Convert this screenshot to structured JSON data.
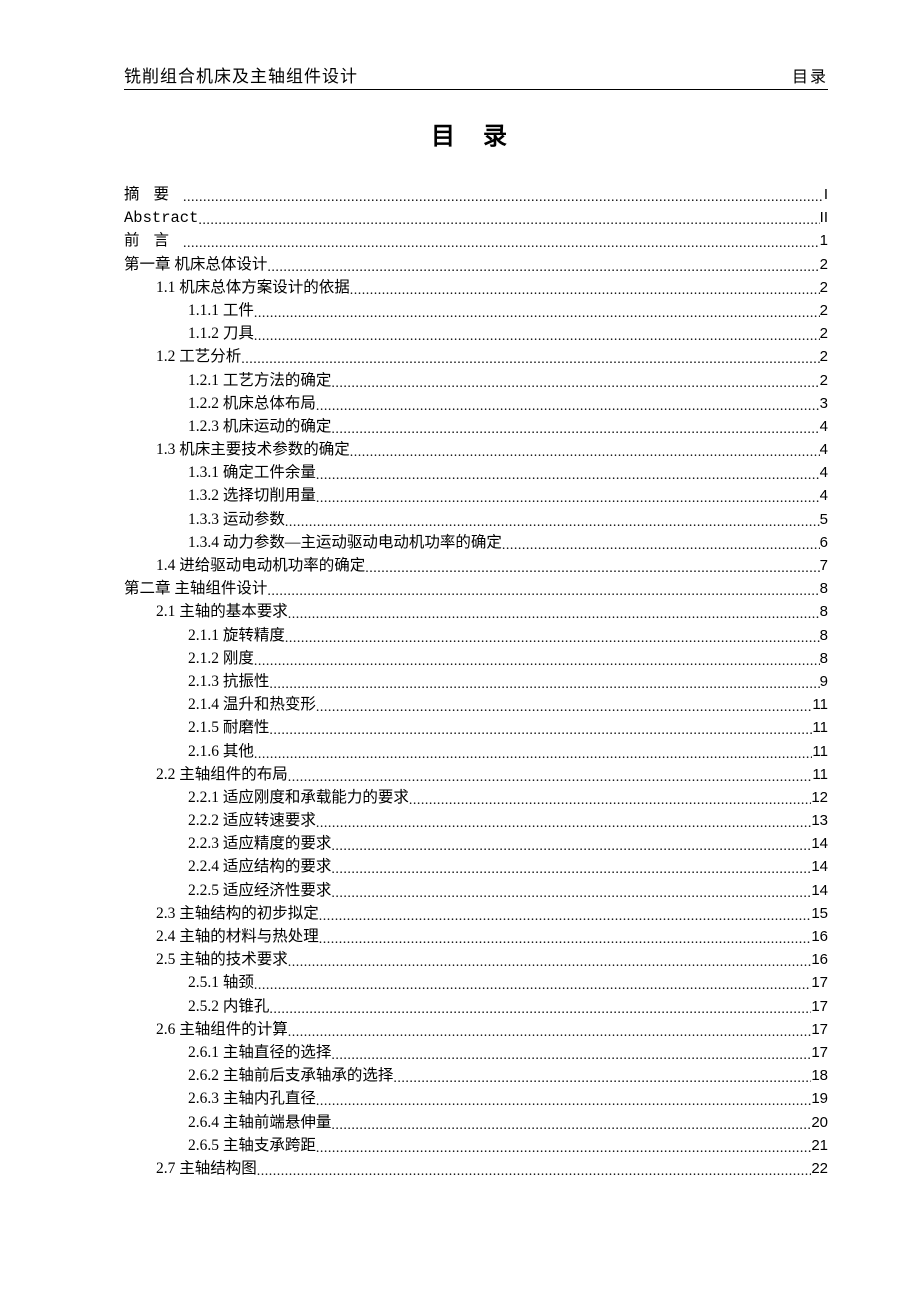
{
  "header": {
    "left": "铣削组合机床及主轴组件设计",
    "right": "目录"
  },
  "title": "目录",
  "toc": [
    {
      "label": "摘要",
      "page": "I",
      "indent": 0,
      "spaced": true
    },
    {
      "label": "Abstract",
      "page": "II",
      "indent": 0,
      "mono": true
    },
    {
      "label": "前言",
      "page": "1",
      "indent": 0,
      "spaced": true
    },
    {
      "label": "第一章 机床总体设计",
      "page": "2",
      "indent": 0
    },
    {
      "label": "1.1 机床总体方案设计的依据",
      "page": "2",
      "indent": 1
    },
    {
      "label": "1.1.1 工件",
      "page": "2",
      "indent": 2
    },
    {
      "label": "1.1.2 刀具",
      "page": "2",
      "indent": 2
    },
    {
      "label": "1.2 工艺分析",
      "page": "2",
      "indent": 1
    },
    {
      "label": "1.2.1 工艺方法的确定",
      "page": "2",
      "indent": 2
    },
    {
      "label": "1.2.2 机床总体布局",
      "page": "3",
      "indent": 2
    },
    {
      "label": "1.2.3 机床运动的确定",
      "page": "4",
      "indent": 2
    },
    {
      "label": "1.3 机床主要技术参数的确定",
      "page": "4",
      "indent": 1
    },
    {
      "label": "1.3.1 确定工件余量",
      "page": "4",
      "indent": 2
    },
    {
      "label": "1.3.2 选择切削用量",
      "page": "4",
      "indent": 2
    },
    {
      "label": "1.3.3 运动参数",
      "page": "5",
      "indent": 2
    },
    {
      "label": "1.3.4 动力参数—主运动驱动电动机功率的确定",
      "page": "6",
      "indent": 2
    },
    {
      "label": "1.4 进给驱动电动机功率的确定",
      "page": "7",
      "indent": 1
    },
    {
      "label": "第二章 主轴组件设计",
      "page": "8",
      "indent": 0
    },
    {
      "label": "2.1 主轴的基本要求",
      "page": "8",
      "indent": 1
    },
    {
      "label": "2.1.1 旋转精度",
      "page": "8",
      "indent": 2
    },
    {
      "label": "2.1.2 刚度",
      "page": "8",
      "indent": 2
    },
    {
      "label": "2.1.3 抗振性",
      "page": "9",
      "indent": 2
    },
    {
      "label": "2.1.4 温升和热变形",
      "page": "11",
      "indent": 2
    },
    {
      "label": "2.1.5 耐磨性",
      "page": "11",
      "indent": 2
    },
    {
      "label": "2.1.6 其他",
      "page": "11",
      "indent": 2
    },
    {
      "label": "2.2 主轴组件的布局",
      "page": "11",
      "indent": 1
    },
    {
      "label": "2.2.1 适应刚度和承载能力的要求",
      "page": "12",
      "indent": 2
    },
    {
      "label": "2.2.2 适应转速要求",
      "page": "13",
      "indent": 2
    },
    {
      "label": "2.2.3 适应精度的要求",
      "page": "14",
      "indent": 2
    },
    {
      "label": "2.2.4 适应结构的要求",
      "page": "14",
      "indent": 2
    },
    {
      "label": "2.2.5 适应经济性要求",
      "page": "14",
      "indent": 2
    },
    {
      "label": "2.3 主轴结构的初步拟定",
      "page": "15",
      "indent": 1
    },
    {
      "label": "2.4 主轴的材料与热处理",
      "page": "16",
      "indent": 1
    },
    {
      "label": "2.5 主轴的技术要求",
      "page": "16",
      "indent": 1
    },
    {
      "label": "2.5.1 轴颈",
      "page": "17",
      "indent": 2
    },
    {
      "label": "2.5.2 内锥孔",
      "page": "17",
      "indent": 2
    },
    {
      "label": "2.6 主轴组件的计算",
      "page": "17",
      "indent": 1
    },
    {
      "label": "2.6.1 主轴直径的选择",
      "page": "17",
      "indent": 2
    },
    {
      "label": "2.6.2 主轴前后支承轴承的选择",
      "page": "18",
      "indent": 2
    },
    {
      "label": "2.6.3 主轴内孔直径",
      "page": "19",
      "indent": 2
    },
    {
      "label": "2.6.4 主轴前端悬伸量",
      "page": "20",
      "indent": 2
    },
    {
      "label": "2.6.5 主轴支承跨距",
      "page": "21",
      "indent": 2
    },
    {
      "label": "2.7 主轴结构图",
      "page": "22",
      "indent": 1
    }
  ]
}
